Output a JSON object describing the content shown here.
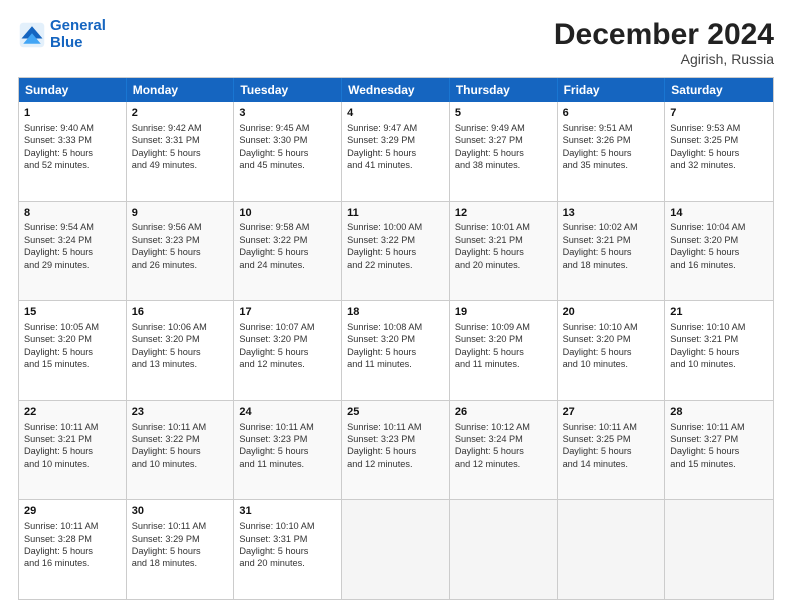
{
  "header": {
    "logo_line1": "General",
    "logo_line2": "Blue",
    "month_title": "December 2024",
    "location": "Agirish, Russia"
  },
  "days_of_week": [
    "Sunday",
    "Monday",
    "Tuesday",
    "Wednesday",
    "Thursday",
    "Friday",
    "Saturday"
  ],
  "rows": [
    [
      {
        "day": "1",
        "info": "Sunrise: 9:40 AM\nSunset: 3:33 PM\nDaylight: 5 hours\nand 52 minutes."
      },
      {
        "day": "2",
        "info": "Sunrise: 9:42 AM\nSunset: 3:31 PM\nDaylight: 5 hours\nand 49 minutes."
      },
      {
        "day": "3",
        "info": "Sunrise: 9:45 AM\nSunset: 3:30 PM\nDaylight: 5 hours\nand 45 minutes."
      },
      {
        "day": "4",
        "info": "Sunrise: 9:47 AM\nSunset: 3:29 PM\nDaylight: 5 hours\nand 41 minutes."
      },
      {
        "day": "5",
        "info": "Sunrise: 9:49 AM\nSunset: 3:27 PM\nDaylight: 5 hours\nand 38 minutes."
      },
      {
        "day": "6",
        "info": "Sunrise: 9:51 AM\nSunset: 3:26 PM\nDaylight: 5 hours\nand 35 minutes."
      },
      {
        "day": "7",
        "info": "Sunrise: 9:53 AM\nSunset: 3:25 PM\nDaylight: 5 hours\nand 32 minutes."
      }
    ],
    [
      {
        "day": "8",
        "info": "Sunrise: 9:54 AM\nSunset: 3:24 PM\nDaylight: 5 hours\nand 29 minutes."
      },
      {
        "day": "9",
        "info": "Sunrise: 9:56 AM\nSunset: 3:23 PM\nDaylight: 5 hours\nand 26 minutes."
      },
      {
        "day": "10",
        "info": "Sunrise: 9:58 AM\nSunset: 3:22 PM\nDaylight: 5 hours\nand 24 minutes."
      },
      {
        "day": "11",
        "info": "Sunrise: 10:00 AM\nSunset: 3:22 PM\nDaylight: 5 hours\nand 22 minutes."
      },
      {
        "day": "12",
        "info": "Sunrise: 10:01 AM\nSunset: 3:21 PM\nDaylight: 5 hours\nand 20 minutes."
      },
      {
        "day": "13",
        "info": "Sunrise: 10:02 AM\nSunset: 3:21 PM\nDaylight: 5 hours\nand 18 minutes."
      },
      {
        "day": "14",
        "info": "Sunrise: 10:04 AM\nSunset: 3:20 PM\nDaylight: 5 hours\nand 16 minutes."
      }
    ],
    [
      {
        "day": "15",
        "info": "Sunrise: 10:05 AM\nSunset: 3:20 PM\nDaylight: 5 hours\nand 15 minutes."
      },
      {
        "day": "16",
        "info": "Sunrise: 10:06 AM\nSunset: 3:20 PM\nDaylight: 5 hours\nand 13 minutes."
      },
      {
        "day": "17",
        "info": "Sunrise: 10:07 AM\nSunset: 3:20 PM\nDaylight: 5 hours\nand 12 minutes."
      },
      {
        "day": "18",
        "info": "Sunrise: 10:08 AM\nSunset: 3:20 PM\nDaylight: 5 hours\nand 11 minutes."
      },
      {
        "day": "19",
        "info": "Sunrise: 10:09 AM\nSunset: 3:20 PM\nDaylight: 5 hours\nand 11 minutes."
      },
      {
        "day": "20",
        "info": "Sunrise: 10:10 AM\nSunset: 3:20 PM\nDaylight: 5 hours\nand 10 minutes."
      },
      {
        "day": "21",
        "info": "Sunrise: 10:10 AM\nSunset: 3:21 PM\nDaylight: 5 hours\nand 10 minutes."
      }
    ],
    [
      {
        "day": "22",
        "info": "Sunrise: 10:11 AM\nSunset: 3:21 PM\nDaylight: 5 hours\nand 10 minutes."
      },
      {
        "day": "23",
        "info": "Sunrise: 10:11 AM\nSunset: 3:22 PM\nDaylight: 5 hours\nand 10 minutes."
      },
      {
        "day": "24",
        "info": "Sunrise: 10:11 AM\nSunset: 3:23 PM\nDaylight: 5 hours\nand 11 minutes."
      },
      {
        "day": "25",
        "info": "Sunrise: 10:11 AM\nSunset: 3:23 PM\nDaylight: 5 hours\nand 12 minutes."
      },
      {
        "day": "26",
        "info": "Sunrise: 10:12 AM\nSunset: 3:24 PM\nDaylight: 5 hours\nand 12 minutes."
      },
      {
        "day": "27",
        "info": "Sunrise: 10:11 AM\nSunset: 3:25 PM\nDaylight: 5 hours\nand 14 minutes."
      },
      {
        "day": "28",
        "info": "Sunrise: 10:11 AM\nSunset: 3:27 PM\nDaylight: 5 hours\nand 15 minutes."
      }
    ],
    [
      {
        "day": "29",
        "info": "Sunrise: 10:11 AM\nSunset: 3:28 PM\nDaylight: 5 hours\nand 16 minutes."
      },
      {
        "day": "30",
        "info": "Sunrise: 10:11 AM\nSunset: 3:29 PM\nDaylight: 5 hours\nand 18 minutes."
      },
      {
        "day": "31",
        "info": "Sunrise: 10:10 AM\nSunset: 3:31 PM\nDaylight: 5 hours\nand 20 minutes."
      },
      {
        "day": "",
        "info": ""
      },
      {
        "day": "",
        "info": ""
      },
      {
        "day": "",
        "info": ""
      },
      {
        "day": "",
        "info": ""
      }
    ]
  ]
}
